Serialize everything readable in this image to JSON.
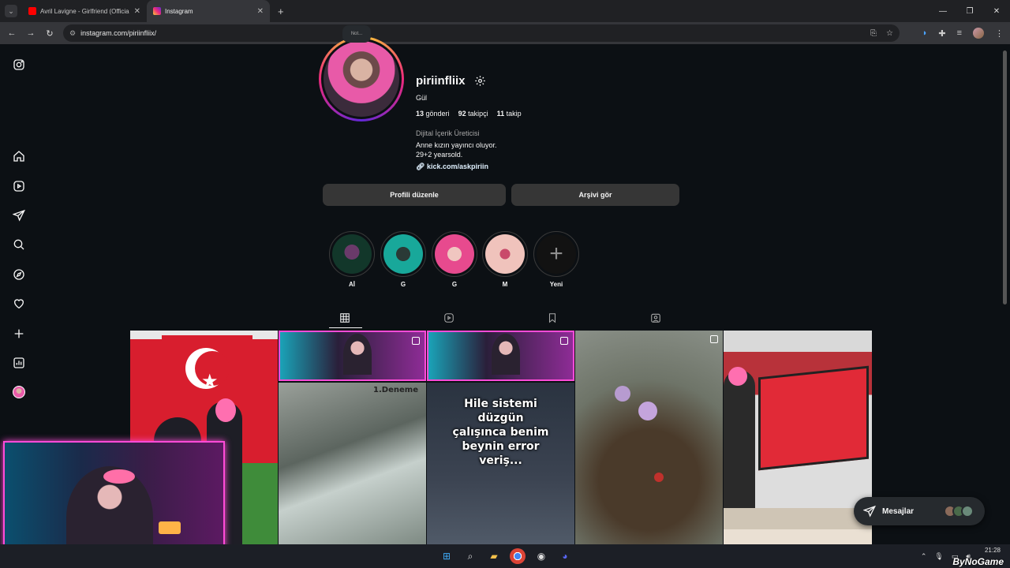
{
  "browser": {
    "tabs": [
      {
        "label": "Avril Lavigne - Girlfriend (Officia",
        "color": "#ff0000"
      },
      {
        "label": "Instagram",
        "color": "#e1306c"
      }
    ],
    "url": "instagram.com/piriinfliix/",
    "close_glyph": "✕",
    "new_tab_glyph": "+",
    "window_controls": [
      "—",
      "❐",
      "✕"
    ]
  },
  "profile": {
    "note": "Not...",
    "username": "piriinfliix",
    "full_name": "Gül",
    "posts_count": "13",
    "posts_label": "gönderi",
    "followers_count": "92",
    "followers_label": "takipçi",
    "following_count": "11",
    "following_label": "takip",
    "category": "Dijital İçerik Üreticisi",
    "bio_line1": "Anne kızın yayıncı oluyor.",
    "bio_line2": "29+2 yearsold.",
    "link": "kick.com/askpiriin",
    "edit_button": "Profili düzenle",
    "archive_button": "Arşivi gör"
  },
  "highlights": [
    {
      "label": "Aİ"
    },
    {
      "label": "G"
    },
    {
      "label": "G"
    },
    {
      "label": "M"
    },
    {
      "label": "Yeni"
    }
  ],
  "posts": {
    "deneme_text": "1.Deneme",
    "hile_text": "Hile sistemi düzgün çalışınca benim beynin error veriş..."
  },
  "messages": {
    "label": "Mesajlar"
  },
  "taskbar": {
    "time": "21:28"
  },
  "watermark": "ByNoGame"
}
